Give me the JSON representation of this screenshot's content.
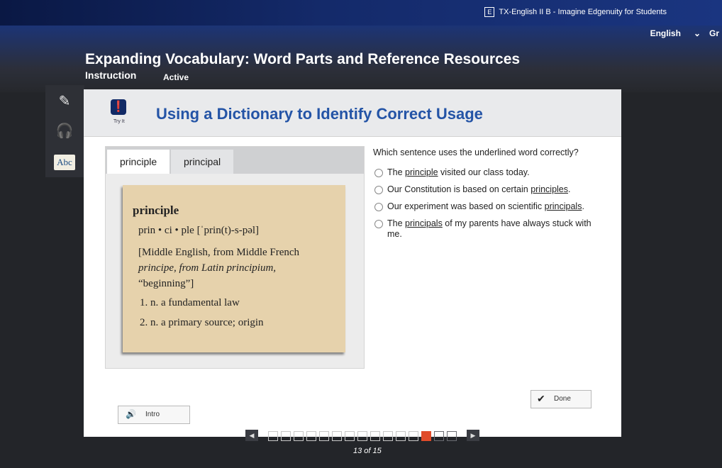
{
  "browser": {
    "tab_title": "TX-English II B - Imagine Edgenuity for Students",
    "tab_icon": "E"
  },
  "language": {
    "label": "English",
    "chevron": "⌄",
    "cut_off": "Gr"
  },
  "header": {
    "title": "Expanding Vocabulary: Word Parts and Reference Resources",
    "section": "Instruction",
    "status": "Active"
  },
  "toolbar": {
    "tools": [
      {
        "icon": "pencil-icon",
        "glyph": "✎"
      },
      {
        "icon": "headphones-icon",
        "glyph": "🎧"
      },
      {
        "icon": "dictionary-icon",
        "glyph": "Abc"
      }
    ]
  },
  "activity": {
    "icon_label": "Try It",
    "title": "Using a Dictionary to Identify Correct Usage"
  },
  "dictionary": {
    "tabs": [
      "principle",
      "principal"
    ],
    "entry": {
      "headword": "principle",
      "pronunciation": "prin • ci • ple [ˈprin(t)-s-pəl]",
      "etymology_1": "[Middle English, from Middle French",
      "etymology_2": "principe, from Latin principium,",
      "etymology_3": "“beginning”]",
      "def1": "1. n. a fundamental law",
      "def2": "2. n. a primary source; origin"
    }
  },
  "question": {
    "prompt": "Which sentence uses the underlined word correctly?",
    "choices": [
      {
        "pre": "The ",
        "word": "principle",
        "post": " visited our class today."
      },
      {
        "pre": "Our Constitution is based on certain ",
        "word": "principles",
        "post": "."
      },
      {
        "pre": "Our experiment was based on scientific ",
        "word": "principals",
        "post": "."
      },
      {
        "pre": "The ",
        "word": "principals",
        "post": " of my parents have always stuck with me."
      }
    ]
  },
  "buttons": {
    "done": "Done",
    "intro": "Intro"
  },
  "pager": {
    "current": 13,
    "total": 15,
    "label": "13 of 15"
  },
  "colors": {
    "accent": "#2454a6",
    "current_page": "#e04b2a",
    "entry_bg": "#e6d2ac"
  }
}
